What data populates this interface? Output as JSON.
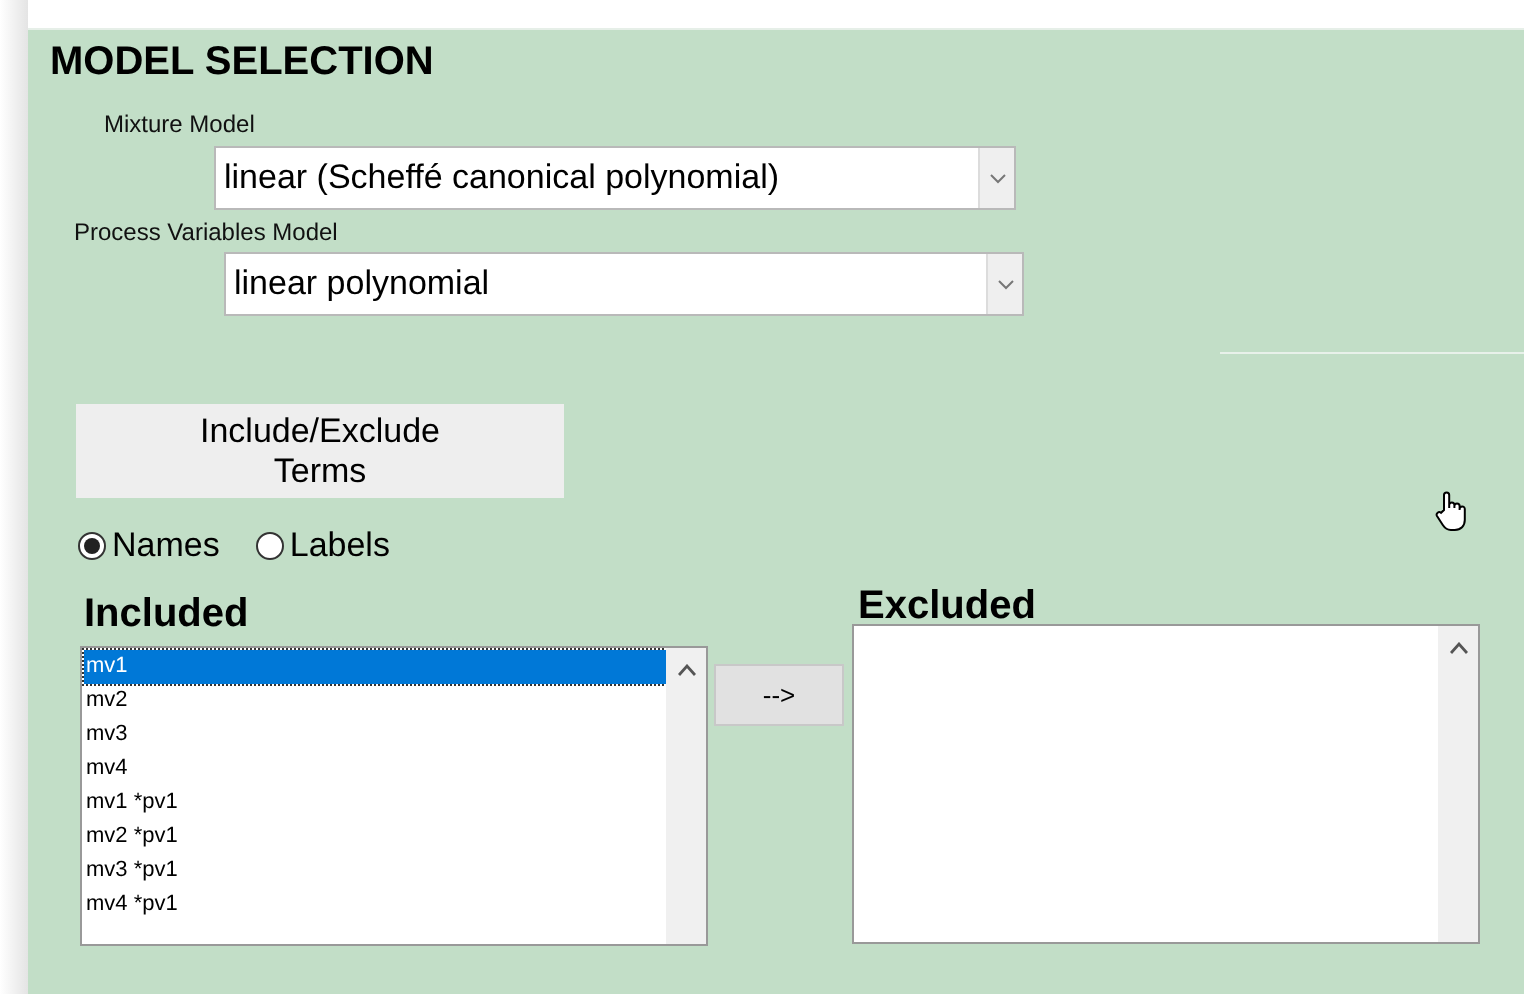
{
  "title": "MODEL SELECTION",
  "mixture_model": {
    "label": "Mixture Model",
    "value": "linear (Scheffé canonical polynomial)"
  },
  "process_model": {
    "label": "Process Variables  Model",
    "value": "linear polynomial"
  },
  "include_exclude_button": "Include/Exclude Terms",
  "display_options": [
    {
      "label": "Names",
      "selected": true
    },
    {
      "label": "Labels",
      "selected": false
    }
  ],
  "included": {
    "heading": "Included",
    "items": [
      {
        "label": "mv1",
        "selected": true
      },
      {
        "label": "mv2",
        "selected": false
      },
      {
        "label": "mv3",
        "selected": false
      },
      {
        "label": "mv4",
        "selected": false
      },
      {
        "label": "mv1 *pv1",
        "selected": false
      },
      {
        "label": "mv2 *pv1",
        "selected": false
      },
      {
        "label": "mv3 *pv1",
        "selected": false
      },
      {
        "label": "mv4 *pv1",
        "selected": false
      }
    ]
  },
  "move_button": "-->",
  "excluded": {
    "heading": "Excluded"
  }
}
